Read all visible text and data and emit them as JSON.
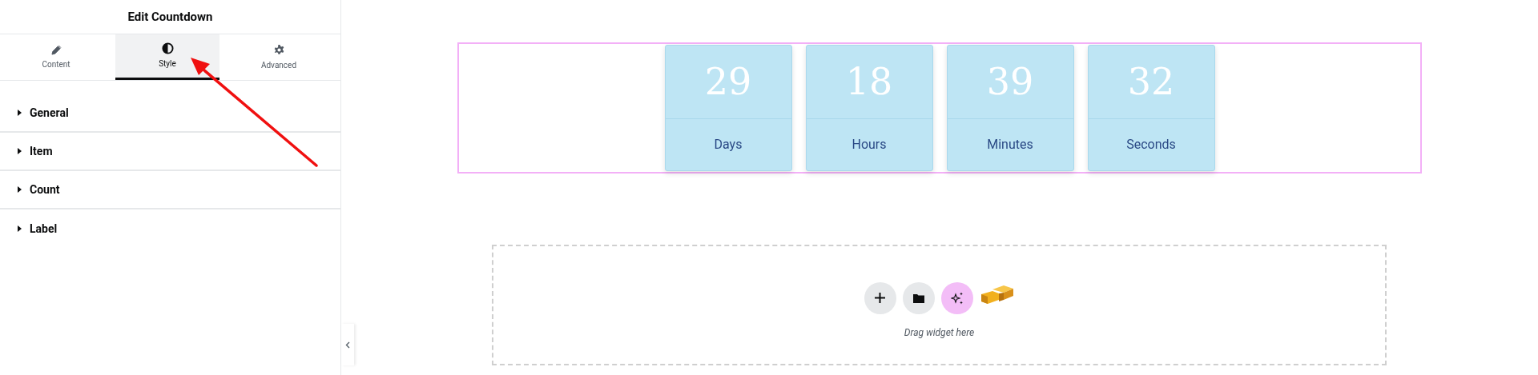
{
  "panel": {
    "title": "Edit Countdown",
    "tabs": [
      {
        "label": "Content",
        "kind": "pencil",
        "selected": false
      },
      {
        "label": "Style",
        "kind": "contrast",
        "selected": true
      },
      {
        "label": "Advanced",
        "kind": "gear",
        "selected": false
      }
    ],
    "sections": [
      {
        "label": "General",
        "expanded": false
      },
      {
        "label": "Item",
        "expanded": false
      },
      {
        "label": "Count",
        "expanded": false
      },
      {
        "label": "Label",
        "expanded": false
      }
    ]
  },
  "countdown": [
    {
      "count": "29",
      "label": "Days"
    },
    {
      "count": "18",
      "label": "Hours"
    },
    {
      "count": "39",
      "label": "Minutes"
    },
    {
      "count": "32",
      "label": "Seconds"
    }
  ],
  "drop_zone": {
    "buttons": [
      {
        "kind": "add"
      },
      {
        "kind": "folder"
      },
      {
        "kind": "ai"
      },
      {
        "kind": "box"
      }
    ],
    "hint": "Drag widget here"
  }
}
